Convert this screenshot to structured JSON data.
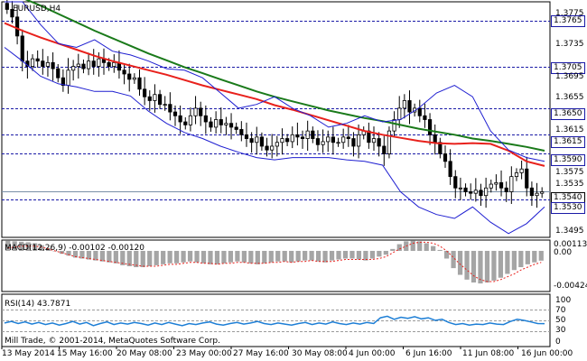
{
  "chart_data": [
    {
      "type": "candlestick",
      "title": "EURUSD,H4",
      "symbol": "EURUSD",
      "timeframe": "H4",
      "ylim": [
        1.348,
        1.379
      ],
      "y_ticks": [
        1.3775,
        1.3735,
        1.3695,
        1.3655,
        1.3615,
        1.3575,
        1.3535,
        1.3495
      ],
      "x_tick_labels": [
        "13 May 2014",
        "15 May 16:00",
        "20 May 08:00",
        "23 May 00:00",
        "27 May 16:00",
        "30 May 08:00",
        "4 Jun 00:00",
        "6 Jun 16:00",
        "11 Jun 08:00",
        "16 Jun 00:00"
      ],
      "levels": [
        {
          "label": "1.3765",
          "value": 1.3765
        },
        {
          "label": "1.3705",
          "value": 1.3705
        },
        {
          "label": "1.3650",
          "value": 1.365
        },
        {
          "label": "1.3615",
          "value": 1.3615
        },
        {
          "label": "1.3590",
          "value": 1.359
        },
        {
          "label": "1.3530",
          "value": 1.353
        }
      ],
      "current_price": 1.354,
      "current_price_label": "1.3540",
      "close_series": [
        1.378,
        1.377,
        1.3745,
        1.3712,
        1.3705,
        1.3715,
        1.3712,
        1.3705,
        1.371,
        1.3702,
        1.369,
        1.368,
        1.37,
        1.3705,
        1.3708,
        1.3702,
        1.3712,
        1.3705,
        1.3715,
        1.371,
        1.3705,
        1.371,
        1.37,
        1.3695,
        1.3688,
        1.369,
        1.3675,
        1.3665,
        1.366,
        1.3668,
        1.3655,
        1.3655,
        1.3645,
        1.364,
        1.3632,
        1.3628,
        1.364,
        1.365,
        1.364,
        1.3632,
        1.3625,
        1.3635,
        1.3628,
        1.363,
        1.3625,
        1.3622,
        1.3615,
        1.361,
        1.3605,
        1.3612,
        1.36,
        1.3595,
        1.36,
        1.3605,
        1.361,
        1.3606,
        1.3615,
        1.3612,
        1.361,
        1.362,
        1.361,
        1.3602,
        1.3606,
        1.3612,
        1.3605,
        1.3605,
        1.3612,
        1.361,
        1.36,
        1.3615,
        1.362,
        1.3605,
        1.361,
        1.36,
        1.359,
        1.362,
        1.3635,
        1.365,
        1.366,
        1.3645,
        1.365,
        1.364,
        1.3635,
        1.3615,
        1.3605,
        1.359,
        1.358,
        1.356,
        1.3545,
        1.3545,
        1.354,
        1.3538,
        1.3542,
        1.3535,
        1.3545,
        1.355,
        1.3552,
        1.3545,
        1.354,
        1.356,
        1.3565,
        1.357,
        1.3545,
        1.3535,
        1.3538,
        1.354
      ],
      "series": [
        {
          "name": "MA red",
          "color": "#e8211c",
          "values": [
            1.3762,
            1.3752,
            1.3743,
            1.3735,
            1.3727,
            1.3719,
            1.3712,
            1.3706,
            1.37,
            1.3694,
            1.3687,
            1.368,
            1.3674,
            1.3668,
            1.3662,
            1.3654,
            1.3648,
            1.3641,
            1.3634,
            1.3627,
            1.362,
            1.3615,
            1.3611,
            1.3607,
            1.3604,
            1.3603,
            1.3604,
            1.3603,
            1.3594,
            1.358,
            1.3574
          ]
        },
        {
          "name": "MA green",
          "color": "#1a7a1a",
          "values": [
            1.3806,
            1.3795,
            1.3785,
            1.3774,
            1.3763,
            1.3752,
            1.3742,
            1.3732,
            1.3722,
            1.3713,
            1.3704,
            1.3696,
            1.3688,
            1.368,
            1.3672,
            1.3665,
            1.3659,
            1.3653,
            1.3647,
            1.3642,
            1.3637,
            1.3633,
            1.3628,
            1.3623,
            1.3619,
            1.3615,
            1.361,
            1.3607,
            1.3603,
            1.3599,
            1.3594
          ]
        },
        {
          "name": "Bollinger upper",
          "color": "#1f1fd1",
          "values": [
            1.379,
            1.379,
            1.376,
            1.3735,
            1.373,
            1.374,
            1.3725,
            1.372,
            1.3712,
            1.3702,
            1.37,
            1.369,
            1.367,
            1.365,
            1.3655,
            1.3665,
            1.365,
            1.364,
            1.3625,
            1.363,
            1.364,
            1.3632,
            1.3635,
            1.365,
            1.367,
            1.368,
            1.3665,
            1.362,
            1.3595,
            1.3585,
            1.358
          ]
        },
        {
          "name": "Bollinger lower",
          "color": "#1f1fd1",
          "values": [
            1.373,
            1.3712,
            1.3692,
            1.3682,
            1.3678,
            1.3672,
            1.3672,
            1.3666,
            1.3646,
            1.363,
            1.3618,
            1.361,
            1.36,
            1.3592,
            1.3585,
            1.3582,
            1.3585,
            1.3585,
            1.3585,
            1.3582,
            1.358,
            1.3575,
            1.354,
            1.352,
            1.351,
            1.3505,
            1.352,
            1.35,
            1.3485,
            1.3498,
            1.352
          ]
        }
      ]
    },
    {
      "type": "bar",
      "title": "MACD(12,26,9) -0.00102 -0.00120",
      "ylim": [
        -0.00424,
        0.00113
      ],
      "y_ticks": [
        0.00113,
        0.0,
        -0.00424
      ],
      "y_tick_labels": [
        "0.00113",
        "0.00",
        "-0.00424"
      ],
      "histogram_color": "#a5a5a5",
      "signal_color": "#e8211c",
      "values": [
        0.00105,
        0.001,
        0.00095,
        0.0009,
        0.0008,
        0.0006,
        0.0003,
        0.0,
        -0.0003,
        -0.0005,
        -0.0007,
        -0.0008,
        -0.0009,
        -0.001,
        -0.0011,
        -0.0012,
        -0.0013,
        -0.0015,
        -0.0016,
        -0.0017,
        -0.0017,
        -0.0016,
        -0.0015,
        -0.0014,
        -0.0013,
        -0.0013,
        -0.0012,
        -0.0011,
        -0.0012,
        -0.0013,
        -0.0014,
        -0.0014,
        -0.0013,
        -0.0012,
        -0.0011,
        -0.0012,
        -0.0013,
        -0.0014,
        -0.0013,
        -0.0012,
        -0.0011,
        -0.0011,
        -0.0012,
        -0.0011,
        -0.001,
        -0.001,
        -0.0011,
        -0.0012,
        -0.001,
        -0.0009,
        -0.0008,
        -0.0008,
        -0.0009,
        -0.001,
        -0.0008,
        -0.0006,
        -0.0004,
        0.0002,
        0.0007,
        0.001,
        0.0011,
        0.001,
        0.0008,
        0.0005,
        0.0001,
        -0.0008,
        -0.0018,
        -0.0025,
        -0.003,
        -0.0033,
        -0.0034,
        -0.0033,
        -0.0031,
        -0.0028,
        -0.0024,
        -0.002,
        -0.0017,
        -0.0014,
        -0.0012,
        -0.00102
      ],
      "signal": [
        0.0003,
        0.0004,
        0.0005,
        0.0005,
        0.0005,
        0.0004,
        0.0002,
        0.0,
        -0.0002,
        -0.0004,
        -0.0006,
        -0.0007,
        -0.0008,
        -0.0009,
        -0.001,
        -0.0011,
        -0.0012,
        -0.0013,
        -0.0014,
        -0.0015,
        -0.0016,
        -0.0016,
        -0.0016,
        -0.0015,
        -0.0014,
        -0.0014,
        -0.0013,
        -0.0012,
        -0.0012,
        -0.0013,
        -0.0013,
        -0.0014,
        -0.0013,
        -0.0013,
        -0.0012,
        -0.0012,
        -0.0013,
        -0.0013,
        -0.0013,
        -0.0012,
        -0.0012,
        -0.0011,
        -0.0012,
        -0.0011,
        -0.0011,
        -0.001,
        -0.0011,
        -0.0011,
        -0.0011,
        -0.001,
        -0.0009,
        -0.0009,
        -0.0009,
        -0.0009,
        -0.0009,
        -0.0008,
        -0.0006,
        -0.0002,
        0.0002,
        0.0005,
        0.0008,
        0.0009,
        0.0009,
        0.0008,
        0.0005,
        0.0,
        -0.0007,
        -0.0014,
        -0.002,
        -0.0026,
        -0.003,
        -0.0032,
        -0.0032,
        -0.003,
        -0.0027,
        -0.0024,
        -0.002,
        -0.0017,
        -0.0014,
        -0.0012
      ]
    },
    {
      "type": "line",
      "title": "RSI(14) 43.7871",
      "ylim": [
        0,
        100
      ],
      "y_ticks": [
        100,
        70,
        50,
        30,
        0
      ],
      "levels": [
        70,
        50,
        30
      ],
      "color": "#1e7fd6",
      "values": [
        45,
        48,
        44,
        47,
        43,
        46,
        42,
        45,
        41,
        44,
        48,
        43,
        46,
        40,
        44,
        47,
        42,
        45,
        43,
        46,
        44,
        41,
        45,
        42,
        46,
        43,
        40,
        44,
        42,
        45,
        47,
        43,
        41,
        44,
        46,
        43,
        45,
        48,
        44,
        42,
        45,
        43,
        41,
        44,
        46,
        42,
        45,
        43,
        47,
        44,
        42,
        45,
        43,
        46,
        44,
        55,
        58,
        52,
        56,
        54,
        57,
        53,
        55,
        50,
        52,
        46,
        42,
        44,
        41,
        43,
        42,
        45,
        43,
        42,
        48,
        52,
        50,
        47,
        44,
        43.7871
      ]
    }
  ],
  "footer": {
    "copyright": "Mill Trade, © 2001-2014, MetaQuotes Software Corp."
  }
}
